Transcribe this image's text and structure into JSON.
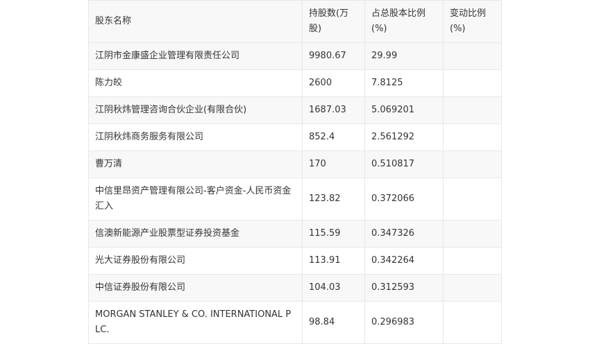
{
  "table": {
    "headers": [
      "股东名称",
      "持股数(万股)",
      "占总股本比例(%)",
      "变动比例(%)"
    ],
    "rows": [
      {
        "name": "江阴市金康盛企业管理有限责任公司",
        "shares": "9980.67",
        "ratio": "29.99",
        "change": ""
      },
      {
        "name": "陈力皎",
        "shares": "2600",
        "ratio": "7.8125",
        "change": ""
      },
      {
        "name": "江阴秋炜管理咨询合伙企业(有限合伙)",
        "shares": "1687.03",
        "ratio": "5.069201",
        "change": ""
      },
      {
        "name": "江阴秋炜商务服务有限公司",
        "shares": "852.4",
        "ratio": "2.561292",
        "change": ""
      },
      {
        "name": "曹万清",
        "shares": "170",
        "ratio": "0.510817",
        "change": ""
      },
      {
        "name": "中信里昂资产管理有限公司-客户资金-人民币资金汇入",
        "shares": "123.82",
        "ratio": "0.372066",
        "change": ""
      },
      {
        "name": "信澳新能源产业股票型证券投资基金",
        "shares": "115.59",
        "ratio": "0.347326",
        "change": ""
      },
      {
        "name": "光大证券股份有限公司",
        "shares": "113.91",
        "ratio": "0.342264",
        "change": ""
      },
      {
        "name": "中信证券股份有限公司",
        "shares": "104.03",
        "ratio": "0.312593",
        "change": ""
      },
      {
        "name": "MORGAN STANLEY & CO. INTERNATIONAL PLC.",
        "shares": "98.84",
        "ratio": "0.296983",
        "change": ""
      }
    ]
  }
}
